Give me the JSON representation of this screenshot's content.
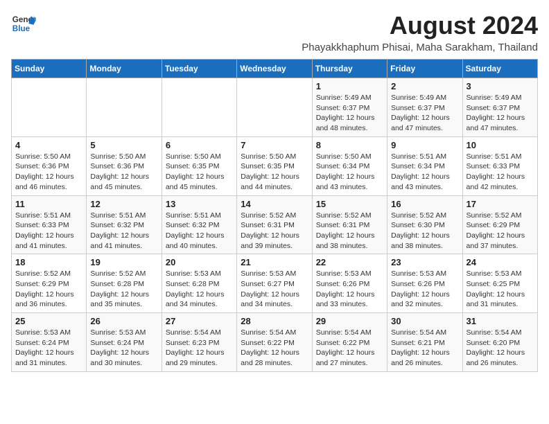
{
  "logo": {
    "line1": "General",
    "line2": "Blue"
  },
  "title": "August 2024",
  "subtitle": "Phayakkhaphum Phisai, Maha Sarakham, Thailand",
  "days_of_week": [
    "Sunday",
    "Monday",
    "Tuesday",
    "Wednesday",
    "Thursday",
    "Friday",
    "Saturday"
  ],
  "weeks": [
    [
      {
        "day": "",
        "info": ""
      },
      {
        "day": "",
        "info": ""
      },
      {
        "day": "",
        "info": ""
      },
      {
        "day": "",
        "info": ""
      },
      {
        "day": "1",
        "info": "Sunrise: 5:49 AM\nSunset: 6:37 PM\nDaylight: 12 hours\nand 48 minutes."
      },
      {
        "day": "2",
        "info": "Sunrise: 5:49 AM\nSunset: 6:37 PM\nDaylight: 12 hours\nand 47 minutes."
      },
      {
        "day": "3",
        "info": "Sunrise: 5:49 AM\nSunset: 6:37 PM\nDaylight: 12 hours\nand 47 minutes."
      }
    ],
    [
      {
        "day": "4",
        "info": "Sunrise: 5:50 AM\nSunset: 6:36 PM\nDaylight: 12 hours\nand 46 minutes."
      },
      {
        "day": "5",
        "info": "Sunrise: 5:50 AM\nSunset: 6:36 PM\nDaylight: 12 hours\nand 45 minutes."
      },
      {
        "day": "6",
        "info": "Sunrise: 5:50 AM\nSunset: 6:35 PM\nDaylight: 12 hours\nand 45 minutes."
      },
      {
        "day": "7",
        "info": "Sunrise: 5:50 AM\nSunset: 6:35 PM\nDaylight: 12 hours\nand 44 minutes."
      },
      {
        "day": "8",
        "info": "Sunrise: 5:50 AM\nSunset: 6:34 PM\nDaylight: 12 hours\nand 43 minutes."
      },
      {
        "day": "9",
        "info": "Sunrise: 5:51 AM\nSunset: 6:34 PM\nDaylight: 12 hours\nand 43 minutes."
      },
      {
        "day": "10",
        "info": "Sunrise: 5:51 AM\nSunset: 6:33 PM\nDaylight: 12 hours\nand 42 minutes."
      }
    ],
    [
      {
        "day": "11",
        "info": "Sunrise: 5:51 AM\nSunset: 6:33 PM\nDaylight: 12 hours\nand 41 minutes."
      },
      {
        "day": "12",
        "info": "Sunrise: 5:51 AM\nSunset: 6:32 PM\nDaylight: 12 hours\nand 41 minutes."
      },
      {
        "day": "13",
        "info": "Sunrise: 5:51 AM\nSunset: 6:32 PM\nDaylight: 12 hours\nand 40 minutes."
      },
      {
        "day": "14",
        "info": "Sunrise: 5:52 AM\nSunset: 6:31 PM\nDaylight: 12 hours\nand 39 minutes."
      },
      {
        "day": "15",
        "info": "Sunrise: 5:52 AM\nSunset: 6:31 PM\nDaylight: 12 hours\nand 38 minutes."
      },
      {
        "day": "16",
        "info": "Sunrise: 5:52 AM\nSunset: 6:30 PM\nDaylight: 12 hours\nand 38 minutes."
      },
      {
        "day": "17",
        "info": "Sunrise: 5:52 AM\nSunset: 6:29 PM\nDaylight: 12 hours\nand 37 minutes."
      }
    ],
    [
      {
        "day": "18",
        "info": "Sunrise: 5:52 AM\nSunset: 6:29 PM\nDaylight: 12 hours\nand 36 minutes."
      },
      {
        "day": "19",
        "info": "Sunrise: 5:52 AM\nSunset: 6:28 PM\nDaylight: 12 hours\nand 35 minutes."
      },
      {
        "day": "20",
        "info": "Sunrise: 5:53 AM\nSunset: 6:28 PM\nDaylight: 12 hours\nand 34 minutes."
      },
      {
        "day": "21",
        "info": "Sunrise: 5:53 AM\nSunset: 6:27 PM\nDaylight: 12 hours\nand 34 minutes."
      },
      {
        "day": "22",
        "info": "Sunrise: 5:53 AM\nSunset: 6:26 PM\nDaylight: 12 hours\nand 33 minutes."
      },
      {
        "day": "23",
        "info": "Sunrise: 5:53 AM\nSunset: 6:26 PM\nDaylight: 12 hours\nand 32 minutes."
      },
      {
        "day": "24",
        "info": "Sunrise: 5:53 AM\nSunset: 6:25 PM\nDaylight: 12 hours\nand 31 minutes."
      }
    ],
    [
      {
        "day": "25",
        "info": "Sunrise: 5:53 AM\nSunset: 6:24 PM\nDaylight: 12 hours\nand 31 minutes."
      },
      {
        "day": "26",
        "info": "Sunrise: 5:53 AM\nSunset: 6:24 PM\nDaylight: 12 hours\nand 30 minutes."
      },
      {
        "day": "27",
        "info": "Sunrise: 5:54 AM\nSunset: 6:23 PM\nDaylight: 12 hours\nand 29 minutes."
      },
      {
        "day": "28",
        "info": "Sunrise: 5:54 AM\nSunset: 6:22 PM\nDaylight: 12 hours\nand 28 minutes."
      },
      {
        "day": "29",
        "info": "Sunrise: 5:54 AM\nSunset: 6:22 PM\nDaylight: 12 hours\nand 27 minutes."
      },
      {
        "day": "30",
        "info": "Sunrise: 5:54 AM\nSunset: 6:21 PM\nDaylight: 12 hours\nand 26 minutes."
      },
      {
        "day": "31",
        "info": "Sunrise: 5:54 AM\nSunset: 6:20 PM\nDaylight: 12 hours\nand 26 minutes."
      }
    ]
  ]
}
